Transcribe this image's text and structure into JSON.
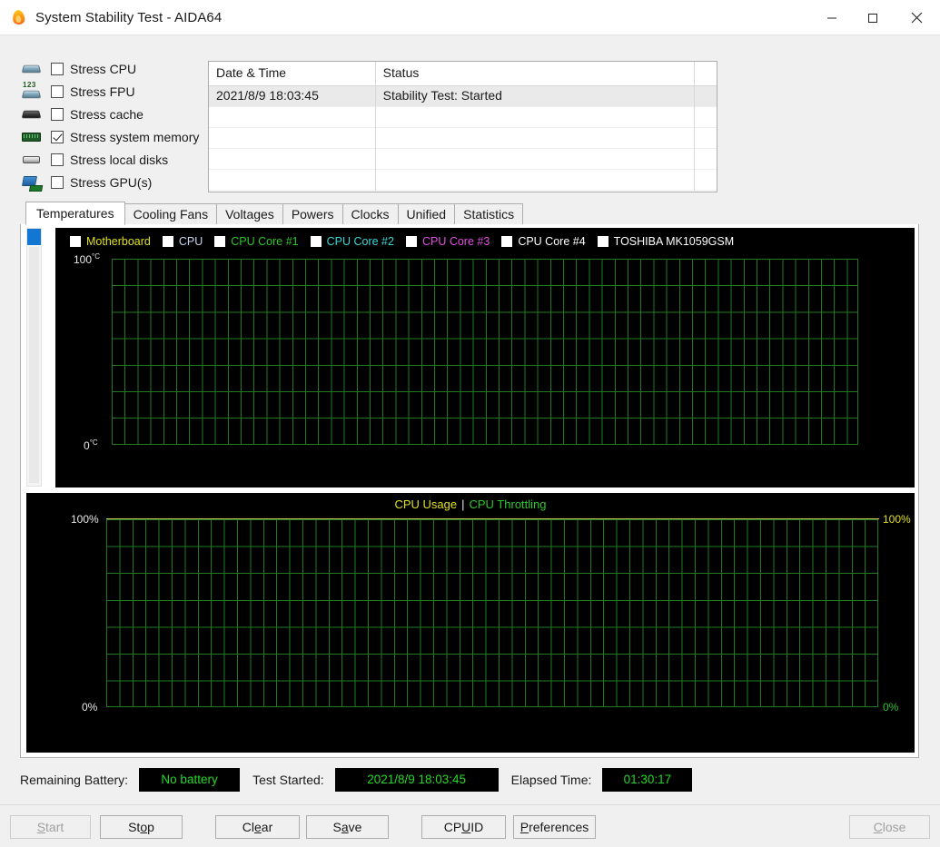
{
  "window": {
    "title": "System Stability Test - AIDA64",
    "icon": "flame-icon",
    "minimize_label": "Minimize",
    "maximize_label": "Maximize",
    "close_label": "Close"
  },
  "stress_options": [
    {
      "label": "Stress CPU",
      "checked": false,
      "icon": "cpu-chip-icon"
    },
    {
      "label": "Stress FPU",
      "checked": false,
      "icon": "fpu-chip-icon"
    },
    {
      "label": "Stress cache",
      "checked": false,
      "icon": "cache-chip-icon"
    },
    {
      "label": "Stress system memory",
      "checked": true,
      "icon": "memory-module-icon"
    },
    {
      "label": "Stress local disks",
      "checked": false,
      "icon": "hard-disk-icon"
    },
    {
      "label": "Stress GPU(s)",
      "checked": false,
      "icon": "gpu-card-icon"
    }
  ],
  "log": {
    "columns": [
      "Date & Time",
      "Status"
    ],
    "rows": [
      {
        "datetime": "2021/8/9 18:03:45",
        "status": "Stability Test: Started",
        "selected": true
      },
      {
        "datetime": "",
        "status": "",
        "selected": false
      },
      {
        "datetime": "",
        "status": "",
        "selected": false
      },
      {
        "datetime": "",
        "status": "",
        "selected": false
      },
      {
        "datetime": "",
        "status": "",
        "selected": false
      }
    ]
  },
  "tabs": [
    {
      "label": "Temperatures",
      "active": true
    },
    {
      "label": "Cooling Fans",
      "active": false
    },
    {
      "label": "Voltages",
      "active": false
    },
    {
      "label": "Powers",
      "active": false
    },
    {
      "label": "Clocks",
      "active": false
    },
    {
      "label": "Unified",
      "active": false
    },
    {
      "label": "Statistics",
      "active": false
    }
  ],
  "chart_data": [
    {
      "type": "line",
      "name": "temperatures-chart",
      "title": "",
      "ylabel_top": "100",
      "ylabel_top_unit": "°C",
      "ylabel_bottom": "0",
      "ylabel_bottom_unit": "°C",
      "ylim": [
        0,
        100
      ],
      "grid": true,
      "grid_color": "#1f7a22",
      "background": "#000000",
      "legend_position": "top",
      "series": [
        {
          "name": "Motherboard",
          "color": "#e0e020",
          "values": []
        },
        {
          "name": "CPU",
          "color": "#c8d4f0",
          "values": []
        },
        {
          "name": "CPU Core #1",
          "color": "#2cc62c",
          "values": []
        },
        {
          "name": "CPU Core #2",
          "color": "#3ad6d6",
          "values": []
        },
        {
          "name": "CPU Core #3",
          "color": "#e24fe2",
          "values": []
        },
        {
          "name": "CPU Core #4",
          "color": "#ffffff",
          "values": []
        },
        {
          "name": "TOSHIBA MK1059GSM",
          "color": "#ffffff",
          "values": []
        }
      ]
    },
    {
      "type": "line",
      "name": "cpu-usage-chart",
      "title_left": "CPU Usage",
      "title_separator": "|",
      "title_right": "CPU Throttling",
      "left_axis_top": "100%",
      "left_axis_bottom": "0%",
      "right_axis_top": "100%",
      "right_axis_bottom": "0%",
      "ylim": [
        0,
        100
      ],
      "grid": true,
      "grid_color": "#1f7a22",
      "background": "#000000",
      "series": [
        {
          "name": "CPU Usage",
          "color": "#e0e020",
          "values": []
        },
        {
          "name": "CPU Throttling",
          "color": "#2cc62c",
          "values": []
        }
      ]
    }
  ],
  "status": {
    "battery_label": "Remaining Battery:",
    "battery_value": "No battery",
    "started_label": "Test Started:",
    "started_value": "2021/8/9 18:03:45",
    "elapsed_label": "Elapsed Time:",
    "elapsed_value": "01:30:17",
    "value_color": "#24d924"
  },
  "buttons": [
    {
      "id": "start",
      "label": "Start",
      "accel": "S",
      "disabled": true
    },
    {
      "id": "stop",
      "label": "Stop",
      "accel": "o",
      "disabled": false
    },
    {
      "id": "clear",
      "label": "Clear",
      "accel": "e",
      "disabled": false
    },
    {
      "id": "save",
      "label": "Save",
      "accel": "a",
      "disabled": false
    },
    {
      "id": "cpuid",
      "label": "CPUID",
      "accel": "U",
      "disabled": false
    },
    {
      "id": "preferences",
      "label": "Preferences",
      "accel": "P",
      "disabled": false
    },
    {
      "id": "close",
      "label": "Close",
      "accel": "C",
      "disabled": true
    }
  ]
}
